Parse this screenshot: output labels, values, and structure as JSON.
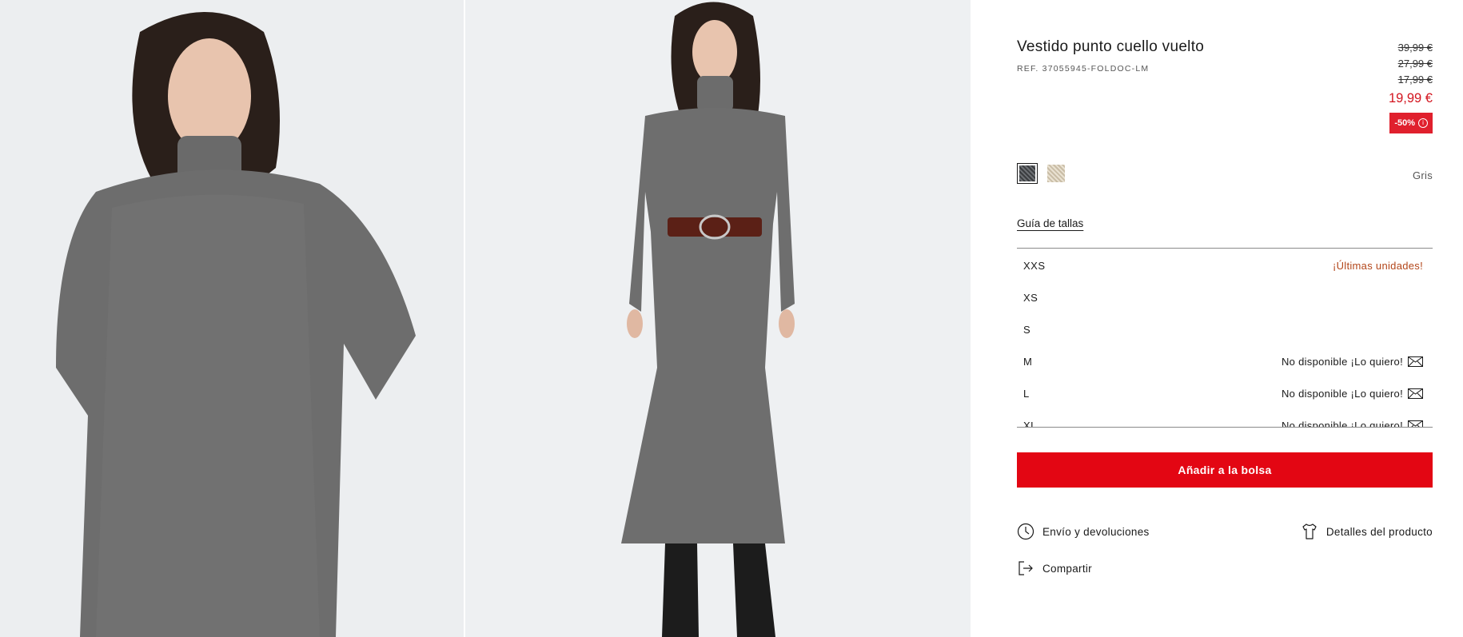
{
  "gallery": {
    "images": [
      {
        "alt": "photo-closeup"
      },
      {
        "alt": "photo-fullbody"
      }
    ]
  },
  "product": {
    "title": "Vestido punto cuello vuelto",
    "ref": "REF. 37055945-FOLDOC-LM",
    "prices": {
      "old": [
        "39,99 €",
        "27,99 €",
        "17,99 €"
      ],
      "current": "19,99 €",
      "discount": "-50%",
      "info_glyph": "i"
    },
    "colors": {
      "swatches": [
        {
          "name": "grey-swatch",
          "selected": true,
          "color": "#55585c"
        },
        {
          "name": "beige-swatch",
          "selected": false,
          "color": "#d8ccb6"
        }
      ],
      "selected_name": "Gris"
    },
    "size_guide": "Guía de tallas",
    "sizes": [
      {
        "label": "XXS",
        "note": "¡Últimas unidades!",
        "status": "last"
      },
      {
        "label": "XS",
        "note": "",
        "status": "available"
      },
      {
        "label": "S",
        "note": "",
        "status": "available"
      },
      {
        "label": "M",
        "note": "No disponible ¡Lo quiero!",
        "status": "unavailable"
      },
      {
        "label": "L",
        "note": "No disponible ¡Lo quiero!",
        "status": "unavailable"
      },
      {
        "label": "XL",
        "note": "No disponible ¡Lo quiero!",
        "status": "unavailable"
      }
    ],
    "add_to_bag": "Añadir a la bolsa",
    "links": {
      "shipping": "Envío y devoluciones",
      "details": "Detalles del producto",
      "share": "Compartir"
    }
  },
  "colors": {
    "accent_red": "#e30613",
    "price_red": "#d3151f",
    "last_units": "#b3461a"
  }
}
